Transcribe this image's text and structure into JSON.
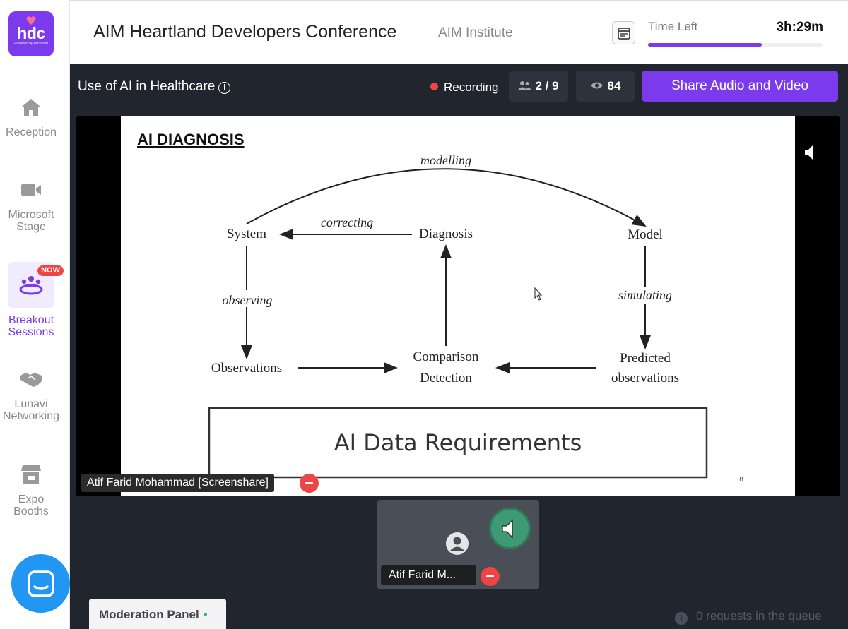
{
  "logo": {
    "text": "hdc",
    "sub": "Powered by Microsoft",
    "icon": "heart-icon"
  },
  "sidebar": {
    "items": [
      {
        "label": "Reception",
        "icon": "home-icon"
      },
      {
        "label": "Microsoft Stage",
        "icon": "video-camera-icon"
      },
      {
        "label": "Breakout Sessions",
        "icon": "people-group-icon",
        "badge": "NOW",
        "active": true
      },
      {
        "label": "Lunavi Networking",
        "icon": "handshake-icon"
      },
      {
        "label": "Expo Booths",
        "icon": "store-icon"
      }
    ]
  },
  "header": {
    "title": "AIM Heartland Developers Conference",
    "organizer": "AIM Institute",
    "time_label": "Time Left",
    "time_value": "3h:29m",
    "time_progress_percent": 65
  },
  "toolbar": {
    "room_title": "Use of AI in Healthcare",
    "recording_label": "Recording",
    "participants": "2 / 9",
    "viewers": "84",
    "share_label": "Share Audio and Video"
  },
  "slide": {
    "heading": "AI DIAGNOSIS",
    "nodes": {
      "system": "System",
      "diagnosis": "Diagnosis",
      "model": "Model",
      "observations": "Observations",
      "comparison": "Comparison",
      "detection": "Detection",
      "predicted": "Predicted",
      "predicted2": "observations"
    },
    "edges": {
      "modelling": "modelling",
      "correcting": "correcting",
      "observing": "observing",
      "simulating": "simulating"
    },
    "box_text": "AI Data Requirements",
    "page_number": "8"
  },
  "stage_name": "Atif Farid Mohammad [Screenshare]",
  "tile_name": "Atif Farid M...",
  "bottom": {
    "moderation": "Moderation Panel",
    "queue": "0 requests in the queue"
  },
  "colors": {
    "accent": "#7c3aed",
    "danger": "#ef4444",
    "dark_bg": "#20252e",
    "speaking": "#3d9a72"
  }
}
